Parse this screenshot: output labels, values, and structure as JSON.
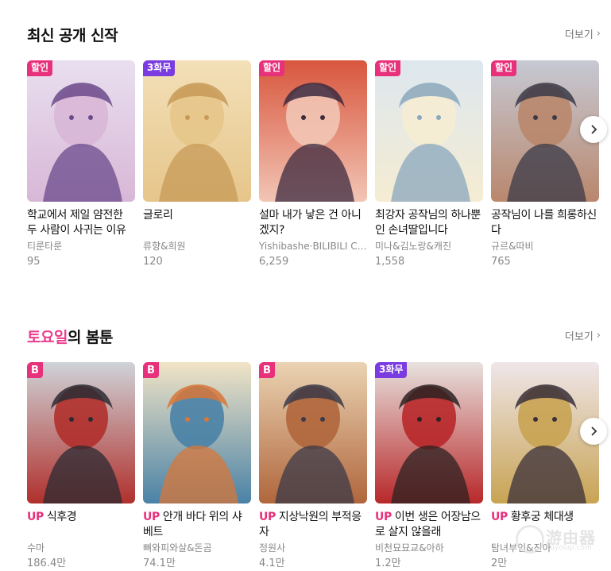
{
  "section_new": {
    "title": "최신 공개 신작",
    "more_label": "더보기",
    "cards": [
      {
        "badge": "할인",
        "badge_type": "sale",
        "title": "학교에서 제일 얌전한 두 사람이 사귀는 이유",
        "author": "티룬타룬",
        "count": "95",
        "art": [
          "#e9dff0",
          "#6b4a8c",
          "#d8b7d6"
        ]
      },
      {
        "badge": "3화무",
        "badge_type": "free",
        "title": "글로리",
        "author": "류향&희원",
        "count": "120",
        "art": [
          "#f3e0b8",
          "#c79a57",
          "#e6c58a"
        ]
      },
      {
        "badge": "할인",
        "badge_type": "sale",
        "title": "설마 내가 낳은 건 아니겠지?",
        "author": "Yishibashe·BILIBILI Comics",
        "count": "6,259",
        "art": [
          "#d8563d",
          "#3c2a3f",
          "#f2c5b5"
        ]
      },
      {
        "badge": "할인",
        "badge_type": "sale",
        "title": "최강자 공작님의 하나뿐인 손녀딸입니다",
        "author": "미나&김노랑&캐진",
        "count": "1,558",
        "art": [
          "#dde7ef",
          "#8aa7bd",
          "#f5ecd2"
        ]
      },
      {
        "badge": "할인",
        "badge_type": "sale",
        "title": "공작님이 나를 희롱하신다",
        "author": "규르&따비",
        "count": "765",
        "art": [
          "#c6c9d4",
          "#3a3a48",
          "#b9876c"
        ]
      }
    ]
  },
  "section_saturday": {
    "title_accent": "토요일",
    "title_rest": "의 봄툰",
    "more_label": "더보기",
    "up_label": "UP",
    "cards": [
      {
        "badge": "B",
        "badge_type": "b",
        "title": "식후경",
        "author": "수마",
        "count": "186.4만",
        "art": [
          "#cfd3d8",
          "#2a2b33",
          "#b0302c"
        ]
      },
      {
        "badge": "B",
        "badge_type": "b",
        "title": "안개 바다 위의 샤베트",
        "author": "뼈와피와살&돈곰",
        "count": "74.1만",
        "art": [
          "#f1e4c6",
          "#d8773a",
          "#4a82a6"
        ]
      },
      {
        "badge": "B",
        "badge_type": "b",
        "title": "지상낙원의 부적응자",
        "author": "정원사",
        "count": "4.1만",
        "art": [
          "#ead3b3",
          "#3b3a48",
          "#b0663c"
        ]
      },
      {
        "badge": "3화무",
        "badge_type": "free",
        "title": "이번 생은 어장남으로 살지 않을래",
        "author": "비천묘묘교&아하",
        "count": "1.2만",
        "art": [
          "#e7e2de",
          "#2b2222",
          "#b8282a"
        ]
      },
      {
        "badge": "",
        "badge_type": "none",
        "title": "황후궁 체대생",
        "author": "탐녀부인&진아",
        "count": "2만",
        "art": [
          "#efe6ea",
          "#3a2f3a",
          "#c8a352"
        ]
      }
    ]
  },
  "icons": {
    "more_chevron": "chevron-right-icon",
    "next_button": "chevron-right-icon"
  },
  "colors": {
    "accent": "#ec3d8f",
    "sale_badge": "#e8317b",
    "free_badge": "#7a3be0"
  }
}
